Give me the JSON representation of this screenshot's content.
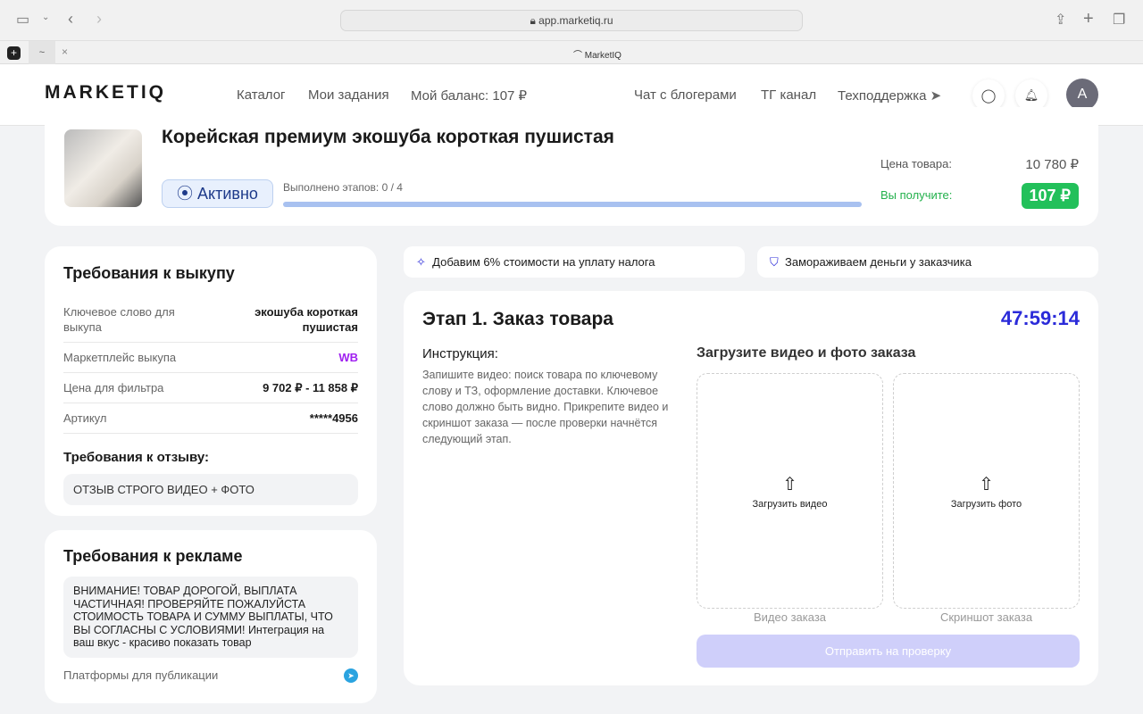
{
  "browser": {
    "url": "app.marketiq.ru",
    "tab_title": "MarketIQ"
  },
  "header": {
    "logo": "MARKETIQ",
    "nav": [
      "Каталог",
      "Мои задания",
      "Мой баланс: 107 ₽"
    ],
    "right_nav": [
      "Чат с блогерами",
      "ТГ канал",
      "Техподдержка"
    ],
    "avatar": "A"
  },
  "product": {
    "title": "Корейская премиум экошуба короткая пушистая",
    "status": "Активно",
    "progress_label": "Выполнено этапов: 0 / 4",
    "progress": 0,
    "price_label": "Цена товара:",
    "price": "10 780 ₽",
    "earn_label": "Вы получите:",
    "earn": "107 ₽"
  },
  "requirements": {
    "title": "Требования к выкупу",
    "rows": [
      {
        "k": "Ключевое слово для выкупа",
        "v": "экошуба короткая пушистая"
      },
      {
        "k": "Маркетплейс выкупа",
        "v": "WB"
      },
      {
        "k": "Цена для фильтра",
        "v": "9 702 ₽ - 11 858 ₽"
      },
      {
        "k": "Артикул",
        "v": "*****4956"
      }
    ],
    "review_title": "Требования к отзыву:",
    "review_text": "ОТЗЫВ СТРОГО ВИДЕО + ФОТО"
  },
  "ads": {
    "title": "Требования к рекламе",
    "text": "ВНИМАНИЕ! ТОВАР ДОРОГОЙ, ВЫПЛАТА ЧАСТИЧНАЯ! ПРОВЕРЯЙТЕ ПОЖАЛУЙСТА СТОИМОСТЬ ТОВАРА И СУММУ ВЫПЛАТЫ, ЧТО ВЫ СОГЛАСНЫ С УСЛОВИЯМИ! Интеграция на ваш вкус - красиво показать товар",
    "platforms_label": "Платформы для публикации"
  },
  "info": {
    "tax": "Добавим 6% стоимости на уплату налога",
    "freeze": "Замораживаем деньги у заказчика"
  },
  "stage": {
    "title": "Этап 1. Заказ товара",
    "timer": "47:59:14",
    "instr_title": "Инструкция:",
    "instr_text": "Запишите видео: поиск товара по ключевому слову и ТЗ, оформление доставки. Ключевое слово должно быть видно. Прикрепите видео и скриншот заказа — после проверки начнётся следующий этап.",
    "upload_title": "Загрузите видео и фото заказа",
    "upload_video": "Загрузить видео",
    "upload_photo": "Загрузить фото",
    "video_caption": "Видео заказа",
    "photo_caption": "Скриншот заказа",
    "submit": "Отправить на проверку"
  },
  "colors": {
    "accent": "#2b2bd9",
    "green": "#22c55e",
    "wb": "#a020f0",
    "submit": "#cfcffa"
  }
}
